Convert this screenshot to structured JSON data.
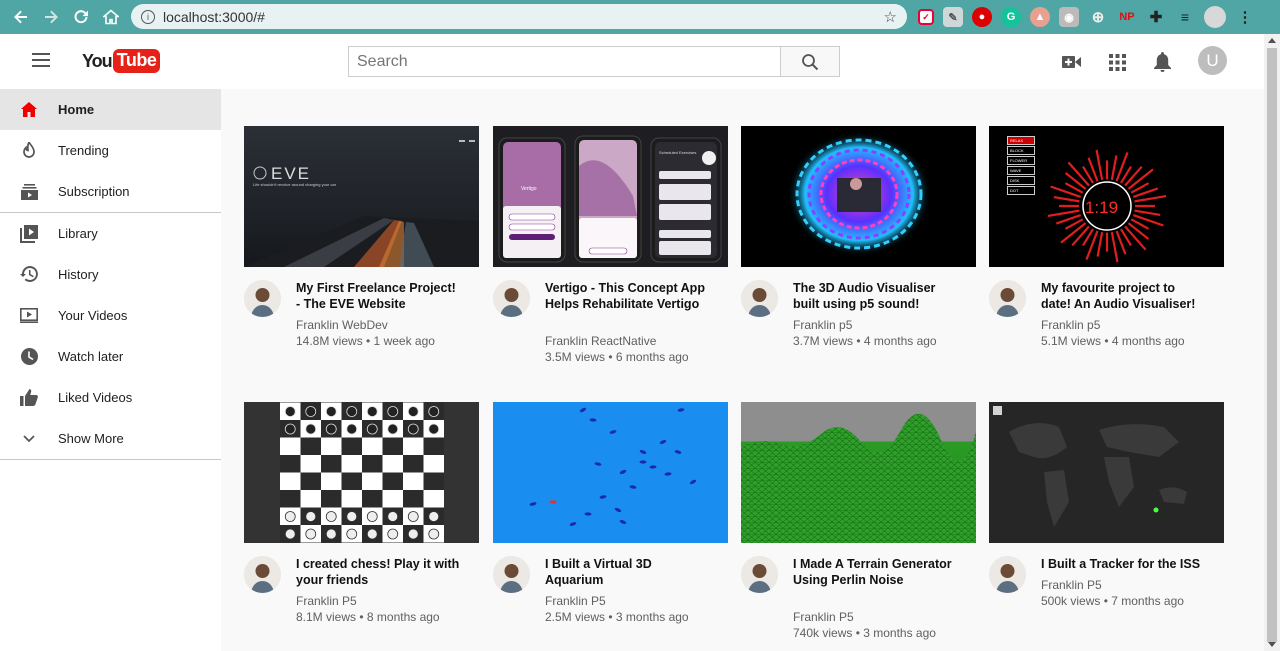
{
  "browser": {
    "url": "localhost:3000/#"
  },
  "masthead": {
    "logo_you": "You",
    "logo_tube": "Tube",
    "search_placeholder": "Search",
    "avatar_letter": "U"
  },
  "sidebar": {
    "items": [
      {
        "label": "Home",
        "icon": "home-icon",
        "active": true
      },
      {
        "label": "Trending",
        "icon": "flame-icon"
      },
      {
        "label": "Subscription",
        "icon": "subscriptions-icon"
      },
      {
        "label": "Library",
        "icon": "library-icon"
      },
      {
        "label": "History",
        "icon": "history-icon"
      },
      {
        "label": "Your Videos",
        "icon": "your-videos-icon"
      },
      {
        "label": "Watch later",
        "icon": "clock-icon"
      },
      {
        "label": "Liked Videos",
        "icon": "thumbs-up-icon"
      },
      {
        "label": "Show More",
        "icon": "chevron-down-icon"
      }
    ]
  },
  "videos": [
    {
      "title": "My First Freelance Project! - The EVE Website",
      "channel": "Franklin WebDev",
      "stats": "14.8M views • 1 week ago",
      "thumb": "eve"
    },
    {
      "title": "Vertigo - This Concept App Helps Rehabilitate Vertigo",
      "channel": "Franklin ReactNative",
      "stats": "3.5M views • 6 months ago",
      "thumb": "vertigo"
    },
    {
      "title": "The 3D Audio Visualiser built using p5 sound!",
      "channel": "Franklin p5",
      "stats": "3.7M views • 4 months ago",
      "thumb": "visualiser3d"
    },
    {
      "title": "My favourite project to date! An Audio Visualiser!",
      "channel": "Franklin p5",
      "stats": "5.1M views • 4 months ago",
      "thumb": "visualiser"
    },
    {
      "title": "I created chess! Play it with your friends",
      "channel": "Franklin P5",
      "stats": "8.1M views • 8 months ago",
      "thumb": "chess"
    },
    {
      "title": "I Built a Virtual 3D Aquarium",
      "channel": "Franklin P5",
      "stats": "2.5M views • 3 months ago",
      "thumb": "aquarium"
    },
    {
      "title": "I Made A Terrain Generator Using Perlin Noise",
      "channel": "Franklin P5",
      "stats": "740k views • 3 months ago",
      "thumb": "terrain"
    },
    {
      "title": "I Built a Tracker for the ISS",
      "channel": "Franklin P5",
      "stats": "500k views • 7 months ago",
      "thumb": "iss"
    }
  ],
  "thumb_text": {
    "eve_logo": "EVE",
    "eve_tagline": "Life shouldn't revolve around charging your car",
    "vertigo_name": "Vertigo",
    "vertigo_exercises": "Scheduled Exercises",
    "visualiser_time": "1:19",
    "visualiser_menu": [
      "RELAX",
      "BLOCK",
      "FLOWER",
      "WAVE",
      "DISK",
      "DOT"
    ]
  }
}
